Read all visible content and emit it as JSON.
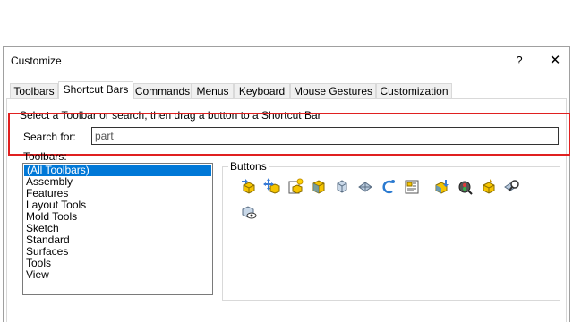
{
  "dialog": {
    "title": "Customize",
    "help_label": "?",
    "close_label": "✕"
  },
  "tabs": [
    {
      "label": "Toolbars",
      "active": false
    },
    {
      "label": "Shortcut Bars",
      "active": true
    },
    {
      "label": "Commands",
      "active": false
    },
    {
      "label": "Menus",
      "active": false
    },
    {
      "label": "Keyboard",
      "active": false
    },
    {
      "label": "Mouse Gestures",
      "active": false
    },
    {
      "label": "Customization",
      "active": false
    }
  ],
  "instruction": "Select a Toolbar or search, then drag a button to a Shortcut Bar",
  "search": {
    "label": "Search for:",
    "value": "part"
  },
  "toolbars": {
    "label": "Toolbars:",
    "items": [
      "(All Toolbars)",
      "Assembly",
      "Features",
      "Layout Tools",
      "Mold Tools",
      "Sketch",
      "Standard",
      "Surfaces",
      "Tools",
      "View"
    ],
    "selected": "(All Toolbars)"
  },
  "buttons": {
    "title": "Buttons",
    "icons": [
      "insert-part-icon",
      "move-part-icon",
      "new-part-icon",
      "part-cube-icon",
      "split-part-icon",
      "mirror-part-icon",
      "derived-part-icon",
      "part-properties-icon",
      "insert-part-into-assembly-icon",
      "part-reviewer-icon",
      "open-part-icon",
      "find-part-icon",
      "view-part-icon"
    ]
  },
  "colors": {
    "highlight": "#e02020",
    "selection": "#0078d7"
  }
}
